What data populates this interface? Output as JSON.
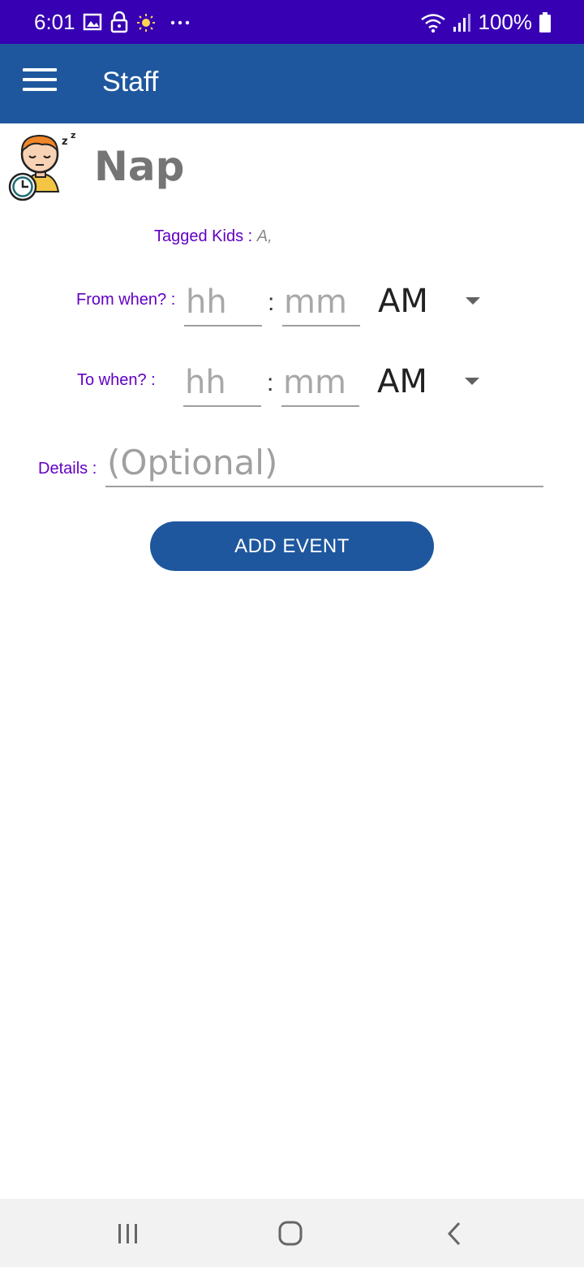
{
  "status_bar": {
    "time": "6:01",
    "battery": "100%",
    "icons": [
      "image-icon",
      "lock-icon",
      "brightness-icon",
      "more-icon",
      "wifi-icon",
      "signal-icon",
      "battery-icon"
    ]
  },
  "app_bar": {
    "title": "Staff",
    "menu_icon": "hamburger-menu-icon",
    "color": "#1e579e"
  },
  "header": {
    "title": "Nap",
    "icon": "sleeping-child-clock-icon"
  },
  "tagged": {
    "label": "Tagged Kids : ",
    "value": "A,"
  },
  "from": {
    "label": "From when? :",
    "hour_placeholder": "hh",
    "minute_placeholder": "mm",
    "separator": ":",
    "ampm": "AM"
  },
  "to": {
    "label": "To when? :",
    "hour_placeholder": "hh",
    "minute_placeholder": "mm",
    "separator": ":",
    "ampm": "AM"
  },
  "details": {
    "label": "Details :",
    "placeholder": "(Optional)"
  },
  "add_button": {
    "label": "ADD EVENT"
  },
  "nav_bar": {
    "items": [
      "recent-apps-icon",
      "home-icon",
      "back-icon"
    ]
  },
  "colors": {
    "status_bar": "#3700b3",
    "accent": "#1e579e",
    "label_purple": "#6200c4"
  }
}
